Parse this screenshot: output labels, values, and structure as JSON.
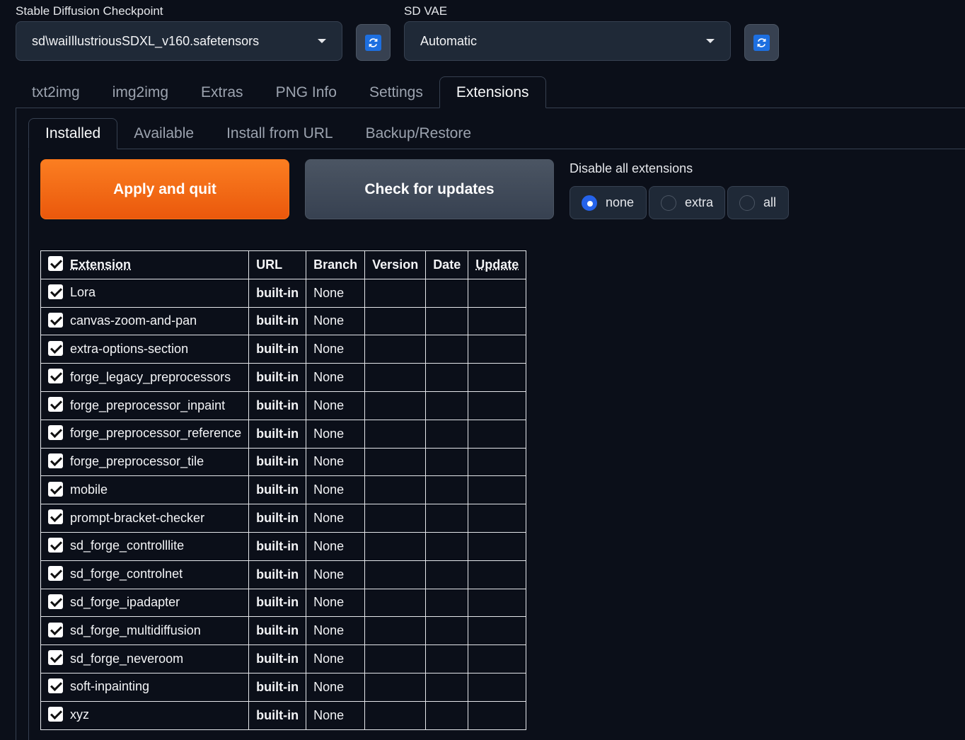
{
  "top": {
    "checkpoint_label": "Stable Diffusion Checkpoint",
    "checkpoint_value": "sd\\waiIllustriousSDXL_v160.safetensors",
    "vae_label": "SD VAE",
    "vae_value": "Automatic"
  },
  "main_tabs": [
    "txt2img",
    "img2img",
    "Extras",
    "PNG Info",
    "Settings",
    "Extensions"
  ],
  "sub_tabs": [
    "Installed",
    "Available",
    "Install from URL",
    "Backup/Restore"
  ],
  "actions": {
    "apply_label": "Apply and quit",
    "check_label": "Check for updates"
  },
  "disable": {
    "label": "Disable all extensions",
    "options": [
      "none",
      "extra",
      "all"
    ],
    "selected": "none"
  },
  "table": {
    "headers": [
      "Extension",
      "URL",
      "Branch",
      "Version",
      "Date",
      "Update"
    ],
    "rows": [
      {
        "name": "Lora",
        "url": "built-in",
        "branch": "None"
      },
      {
        "name": "canvas-zoom-and-pan",
        "url": "built-in",
        "branch": "None"
      },
      {
        "name": "extra-options-section",
        "url": "built-in",
        "branch": "None"
      },
      {
        "name": "forge_legacy_preprocessors",
        "url": "built-in",
        "branch": "None"
      },
      {
        "name": "forge_preprocessor_inpaint",
        "url": "built-in",
        "branch": "None"
      },
      {
        "name": "forge_preprocessor_reference",
        "url": "built-in",
        "branch": "None"
      },
      {
        "name": "forge_preprocessor_tile",
        "url": "built-in",
        "branch": "None"
      },
      {
        "name": "mobile",
        "url": "built-in",
        "branch": "None"
      },
      {
        "name": "prompt-bracket-checker",
        "url": "built-in",
        "branch": "None"
      },
      {
        "name": "sd_forge_controlllite",
        "url": "built-in",
        "branch": "None"
      },
      {
        "name": "sd_forge_controlnet",
        "url": "built-in",
        "branch": "None"
      },
      {
        "name": "sd_forge_ipadapter",
        "url": "built-in",
        "branch": "None"
      },
      {
        "name": "sd_forge_multidiffusion",
        "url": "built-in",
        "branch": "None"
      },
      {
        "name": "sd_forge_neveroom",
        "url": "built-in",
        "branch": "None"
      },
      {
        "name": "soft-inpainting",
        "url": "built-in",
        "branch": "None"
      },
      {
        "name": "xyz",
        "url": "built-in",
        "branch": "None"
      }
    ]
  },
  "colors": {
    "background": "#0b0f19",
    "primary": "#f97316",
    "secondary": "#4b5563",
    "radio_selected": "#2563eb",
    "refresh_icon": "#1d6fe0"
  }
}
